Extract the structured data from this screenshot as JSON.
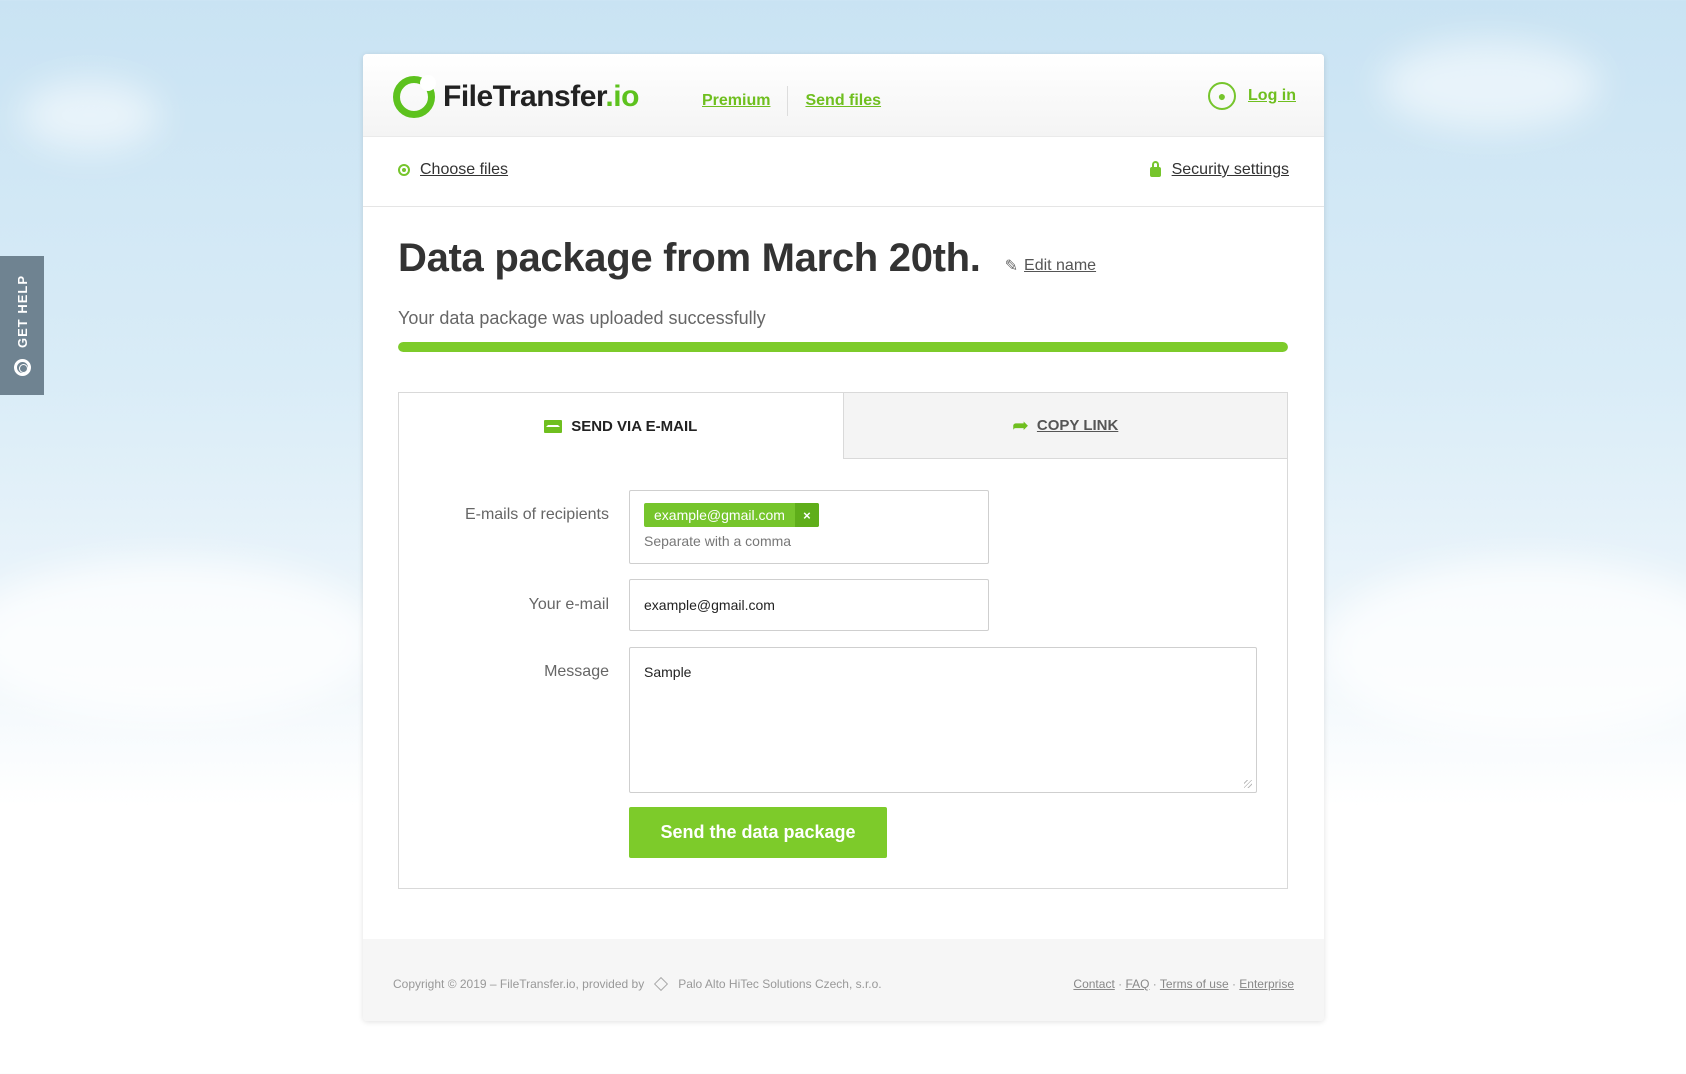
{
  "brand": {
    "name_main": "FileTransfer",
    "name_suffix": ".io",
    "accent": "#76c52c"
  },
  "nav": {
    "premium": "Premium",
    "send_files": "Send files",
    "login": "Log in"
  },
  "toolbar": {
    "choose_files": "Choose files",
    "security_settings": "Security settings"
  },
  "package": {
    "title": "Data package from March 20th.",
    "edit_name": "Edit name",
    "status": "Your data package was uploaded successfully",
    "progress": 1.0
  },
  "tabs": {
    "email": "SEND VIA E-MAIL",
    "copy_link": "COPY LINK"
  },
  "form": {
    "recipients_label": "E-mails of recipients",
    "recipient_chip": "example@gmail.com",
    "chip_remove": "×",
    "recipients_hint": "Separate with a comma",
    "your_email_label": "Your e-mail",
    "your_email_value": "example@gmail.com",
    "message_label": "Message",
    "message_value": "Sample",
    "send_button": "Send the data package"
  },
  "footer": {
    "copyright": "Copyright © 2019 – FileTransfer.io, provided by",
    "company": "Palo Alto HiTec Solutions Czech, s.r.o.",
    "links": [
      "Contact",
      "FAQ",
      "Terms of use",
      "Enterprise"
    ]
  },
  "help": {
    "label": "GET HELP"
  }
}
